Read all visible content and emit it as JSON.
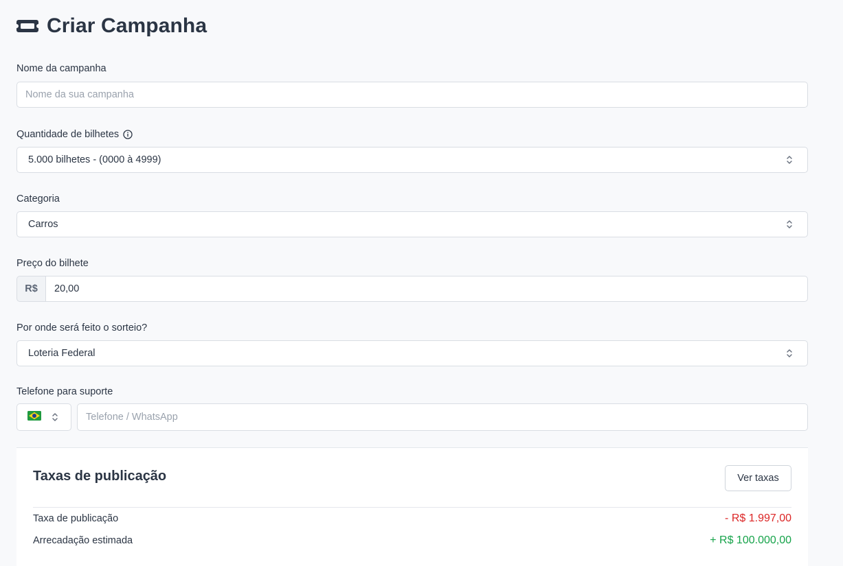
{
  "page": {
    "title": "Criar Campanha"
  },
  "form": {
    "name": {
      "label": "Nome da campanha",
      "placeholder": "Nome da sua campanha"
    },
    "tickets": {
      "label": "Quantidade de bilhetes",
      "value": "5.000 bilhetes - (0000 à 4999)"
    },
    "category": {
      "label": "Categoria",
      "value": "Carros"
    },
    "price": {
      "label": "Preço do bilhete",
      "prefix": "R$",
      "value": "20,00"
    },
    "draw": {
      "label": "Por onde será feito o sorteio?",
      "value": "Loteria Federal"
    },
    "phone": {
      "label": "Telefone para suporte",
      "placeholder": "Telefone / WhatsApp",
      "country": "Brasil"
    }
  },
  "fees": {
    "title": "Taxas de publicação",
    "button": "Ver taxas",
    "rows": [
      {
        "label": "Taxa de publicação",
        "value": "- R$ 1.997,00"
      },
      {
        "label": "Arrecadação estimada",
        "value": "+ R$ 100.000,00"
      }
    ]
  },
  "colors": {
    "negative": "#dc2626",
    "positive": "#16a34a",
    "text": "#2b3544"
  }
}
